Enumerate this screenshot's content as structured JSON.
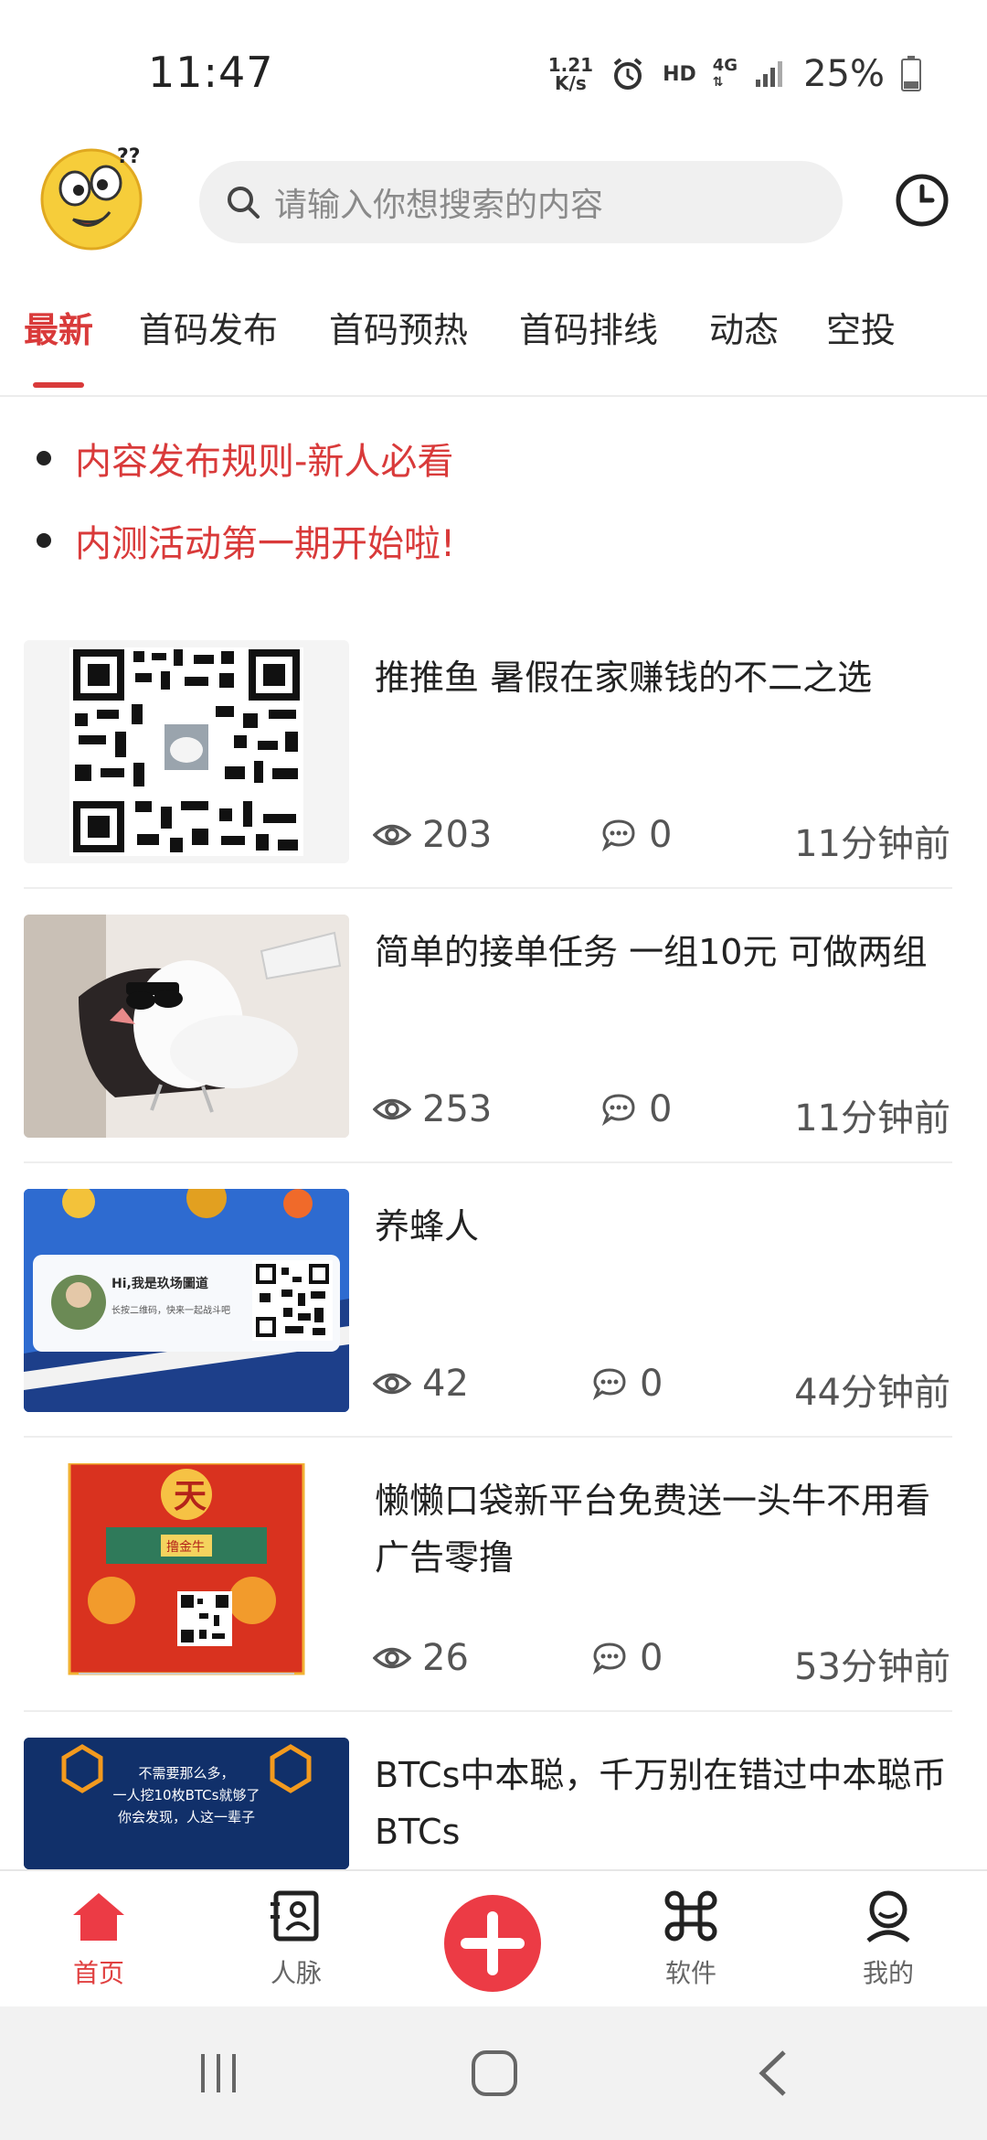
{
  "status_bar": {
    "time": "11:47",
    "net_speed_top": "1.21",
    "net_speed_bottom": "K/s",
    "hd": "HD",
    "network": "4G",
    "battery": "25%"
  },
  "header": {
    "search_placeholder": "请输入你想搜索的内容"
  },
  "tabs": [
    "最新",
    "首码发布",
    "首码预热",
    "首码排线",
    "动态",
    "空投"
  ],
  "notices": [
    "内容发布规则-新人必看",
    "内测活动第一期开始啦!"
  ],
  "posts": [
    {
      "title": "推推鱼 暑假在家赚钱的不二之选",
      "views": "203",
      "comments": "0",
      "time": "11分钟前"
    },
    {
      "title": "简单的接单任务 一组10元 可做两组",
      "views": "253",
      "comments": "0",
      "time": "11分钟前"
    },
    {
      "title": "养蜂人",
      "views": "42",
      "comments": "0",
      "time": "44分钟前"
    },
    {
      "title": "懒懒口袋新平台免费送一头牛不用看广告零撸",
      "views": "26",
      "comments": "0",
      "time": "53分钟前"
    },
    {
      "title": "BTCs中本聪，千万别在错过中本聪币BTCs",
      "views": "",
      "comments": "",
      "time": ""
    }
  ],
  "thumb_text": {
    "card_greeting": "Hi,我是玖场圖道",
    "card_sub": "长按二维码，快来一起战斗吧",
    "poster_top": "天",
    "poster_sign": "撸金牛",
    "btc_line1": "不需要那么多，",
    "btc_line2": "一人挖10枚BTCs就够了",
    "btc_line3": "你会发现，人这一辈子"
  },
  "bottom_nav": {
    "home": "首页",
    "contacts": "人脉",
    "software": "软件",
    "mine": "我的"
  },
  "colors": {
    "accent": "#d93a3a",
    "plus_button": "#ec3b45"
  }
}
